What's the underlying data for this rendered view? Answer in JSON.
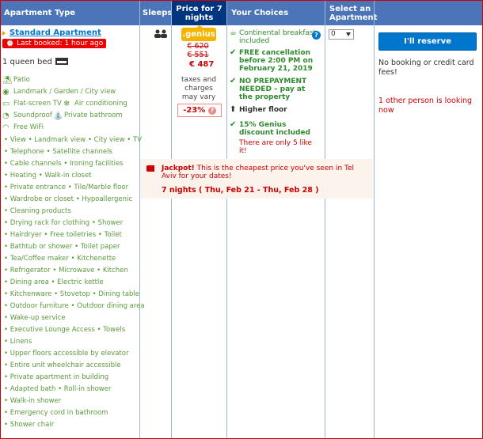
{
  "header": {
    "apartment_type": "Apartment Type",
    "sleeps": "Sleeps",
    "price": "Price for 7 nights",
    "choices": "Your Choices",
    "select": "Select an Apartment"
  },
  "room": {
    "name": "Standard Apartment",
    "last_booked": "Last booked: 1 hour ago",
    "bed": "1 queen bed",
    "facilities": [
      {
        "icon": "patio-icon",
        "label": "Patio"
      },
      {
        "icon": "view-icon",
        "label": "Landmark / Garden / City view"
      },
      {
        "icon": "tv-icon",
        "label": "Flat-screen TV"
      },
      {
        "icon": "snowflake-icon",
        "label": "Air conditioning"
      },
      {
        "icon": "soundproof-icon",
        "label": "Soundproof"
      },
      {
        "icon": "shower-icon",
        "label": "Private bathroom"
      },
      {
        "icon": "wifi-icon",
        "label": "Free WiFi"
      }
    ],
    "amenity_rows": [
      [
        "View",
        "Landmark view",
        "City view",
        "TV"
      ],
      [
        "Telephone",
        "Satellite channels"
      ],
      [
        "Cable channels",
        "Ironing facilities"
      ],
      [
        "Heating",
        "Walk-in closet"
      ],
      [
        "Private entrance",
        "Tile/Marble floor"
      ],
      [
        "Wardrobe or closet",
        "Hypoallergenic"
      ],
      [
        "Cleaning products"
      ],
      [
        "Drying rack for clothing",
        "Shower"
      ],
      [
        "Hairdryer",
        "Free toiletries",
        "Toilet"
      ],
      [
        "Bathtub or shower",
        "Toilet paper"
      ],
      [
        "Tea/Coffee maker",
        "Kitchenette"
      ],
      [
        "Refrigerator",
        "Microwave",
        "Kitchen"
      ],
      [
        "Dining area",
        "Electric kettle"
      ],
      [
        "Kitchenware",
        "Stovetop",
        "Dining table"
      ],
      [
        "Outdoor furniture",
        "Outdoor dining area"
      ],
      [
        "Wake-up service"
      ],
      [
        "Executive Lounge Access",
        "Towels"
      ],
      [
        "Linens"
      ],
      [
        "Upper floors accessible by elevator"
      ],
      [
        "Entire unit wheelchair accessible"
      ],
      [
        "Private apartment in building"
      ],
      [
        "Adapted bath",
        "Roll-in shower"
      ],
      [
        "Walk-in shower"
      ],
      [
        "Emergency cord in bathroom"
      ],
      [
        "Shower chair"
      ]
    ]
  },
  "price": {
    "genius_label": ".genius",
    "old_price_1": "€ 620",
    "old_price_2": "€ 551",
    "new_price": "€ 487",
    "tax_note": "taxes and charges may vary",
    "discount": "-23%",
    "discount_help": "?"
  },
  "choices": [
    {
      "icon": "coffee-icon",
      "text": "Continental breakfast included",
      "style": "green"
    },
    {
      "icon": "check-icon",
      "text": "FREE cancellation before 2:00 PM on February 21, 2019",
      "style": "green-b"
    },
    {
      "icon": "check-icon",
      "text": "NO PREPAYMENT NEEDED – pay at the property",
      "style": "green-b"
    },
    {
      "icon": "arrow-up-icon",
      "text": "Higher floor",
      "style": "blk-b"
    },
    {
      "icon": "check-icon",
      "text": "15% Genius discount included",
      "style": "green-b"
    }
  ],
  "only_left": "There are only 5 like it!",
  "info_help": "?",
  "select": {
    "value": "0"
  },
  "reserve": {
    "button": "I'll reserve",
    "no_fees": "No booking or credit card fees!",
    "looking": "1 other person is looking now"
  },
  "jackpot": {
    "title": "Jackpot!",
    "text": "This is the cheapest price you've seen in Tel Aviv for your dates!",
    "dates": "7 nights ( Thu, Feb 21 - Thu, Feb 28 )"
  },
  "colors": {
    "header_bg": "#4b75b8",
    "price_header_bg": "#003580",
    "genius": "#f5b400",
    "reserve": "#0077cc",
    "alert_red": "#cc0000",
    "amenity_green": "#5a9a3c"
  }
}
